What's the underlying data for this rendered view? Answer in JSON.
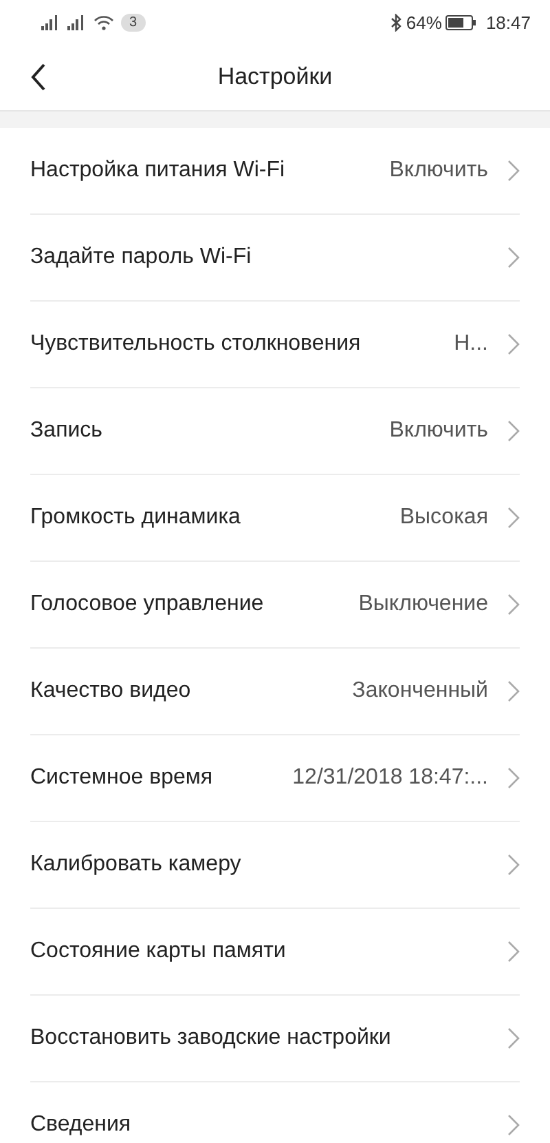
{
  "status_bar": {
    "notification_count": "3",
    "battery": "64%",
    "time": "18:47"
  },
  "header": {
    "title": "Настройки"
  },
  "settings": [
    {
      "label": "Настройка питания Wi-Fi",
      "value": "Включить"
    },
    {
      "label": "Задайте пароль Wi-Fi"
    },
    {
      "label": "Чувствительность столкновения",
      "value": "Н..."
    },
    {
      "label": "Запись",
      "value": "Включить"
    },
    {
      "label": "Громкость динамика",
      "value": "Высокая"
    },
    {
      "label": "Голосовое управление",
      "value": "Выключение"
    },
    {
      "label": "Качество видео",
      "value": "Законченный"
    },
    {
      "label": "Системное время",
      "value": "12/31/2018 18:47:..."
    },
    {
      "label": "Калибровать камеру"
    },
    {
      "label": "Состояние карты памяти"
    },
    {
      "label": "Восстановить заводские настройки"
    },
    {
      "label": "Сведения"
    }
  ]
}
